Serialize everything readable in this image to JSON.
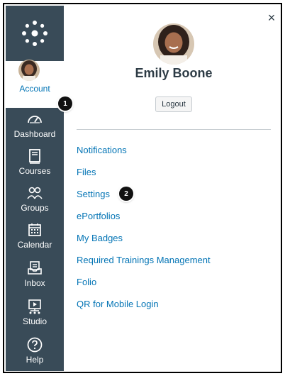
{
  "global_nav": {
    "account_label": "Account",
    "items": [
      {
        "label": "Dashboard",
        "icon": "dashboard-icon"
      },
      {
        "label": "Courses",
        "icon": "courses-icon"
      },
      {
        "label": "Groups",
        "icon": "groups-icon"
      },
      {
        "label": "Calendar",
        "icon": "calendar-icon"
      },
      {
        "label": "Inbox",
        "icon": "inbox-icon"
      },
      {
        "label": "Studio",
        "icon": "studio-icon"
      },
      {
        "label": "Help",
        "icon": "help-icon"
      }
    ]
  },
  "tray": {
    "user_name": "Emily Boone",
    "logout_label": "Logout",
    "links": [
      "Notifications",
      "Files",
      "Settings",
      "ePortfolios",
      "My Badges",
      "Required Trainings Management",
      "Folio",
      "QR for Mobile Login"
    ]
  },
  "markers": [
    "1",
    "2"
  ],
  "colors": {
    "nav_bg": "#394b58",
    "link": "#0374b5",
    "text": "#2d3b45"
  }
}
